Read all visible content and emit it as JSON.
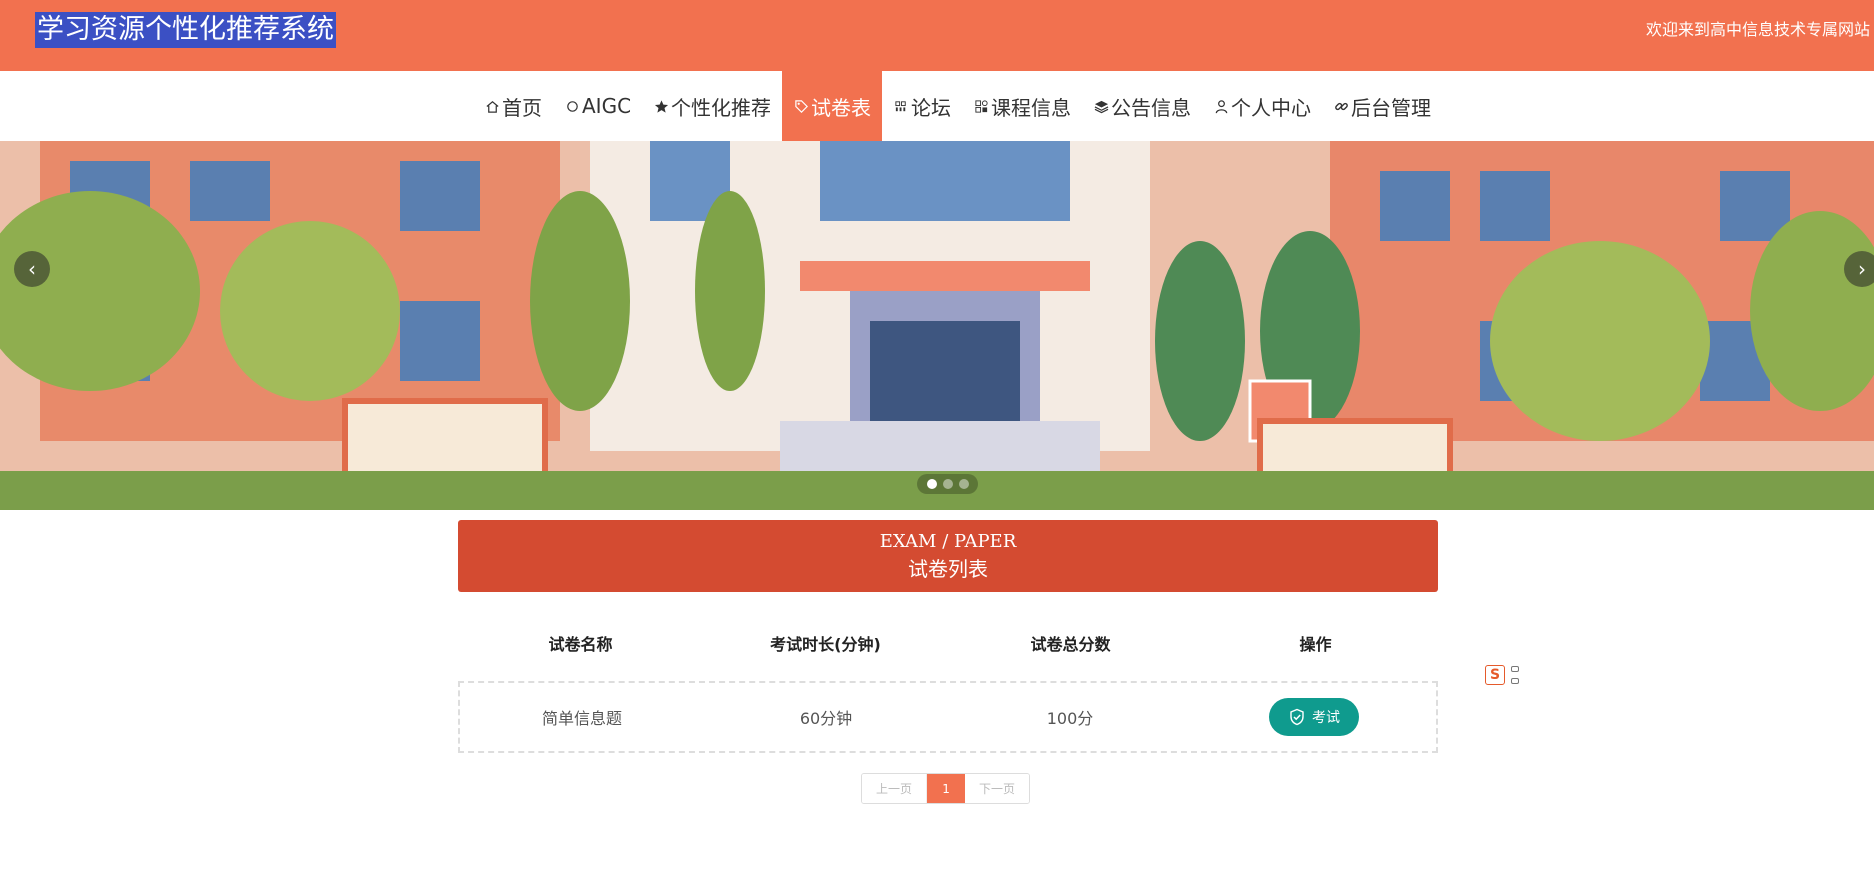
{
  "header": {
    "site_title": "学习资源个性化推荐系统",
    "welcome": "欢迎来到高中信息技术专属网站"
  },
  "nav": {
    "items": [
      {
        "label": "首页",
        "icon": "home-icon"
      },
      {
        "label": "AIGC",
        "icon": "circle-icon"
      },
      {
        "label": "个性化推荐",
        "icon": "star-icon"
      },
      {
        "label": "试卷表",
        "icon": "tag-icon",
        "active": true
      },
      {
        "label": "论坛",
        "icon": "grid-icon"
      },
      {
        "label": "课程信息",
        "icon": "apps-icon"
      },
      {
        "label": "公告信息",
        "icon": "layers-icon"
      },
      {
        "label": "个人中心",
        "icon": "user-icon"
      },
      {
        "label": "后台管理",
        "icon": "link-icon"
      }
    ]
  },
  "carousel": {
    "prev_icon": "chevron-left-icon",
    "next_icon": "chevron-right-icon",
    "slide_count": 3,
    "active_index": 0
  },
  "section": {
    "title_en": "EXAM / PAPER",
    "title_cn": "试卷列表"
  },
  "table": {
    "headers": [
      "试卷名称",
      "考试时长(分钟)",
      "试卷总分数",
      "操作"
    ],
    "rows": [
      {
        "name": "简单信息题",
        "duration": "60分钟",
        "score": "100分",
        "action": "考试"
      }
    ]
  },
  "pagination": {
    "prev": "上一页",
    "current": "1",
    "next": "下一页"
  },
  "widget": {
    "sogou_glyph": "S"
  },
  "colors": {
    "brand": "#f2714f",
    "section": "#d44b31",
    "action": "#0f9b8e"
  }
}
